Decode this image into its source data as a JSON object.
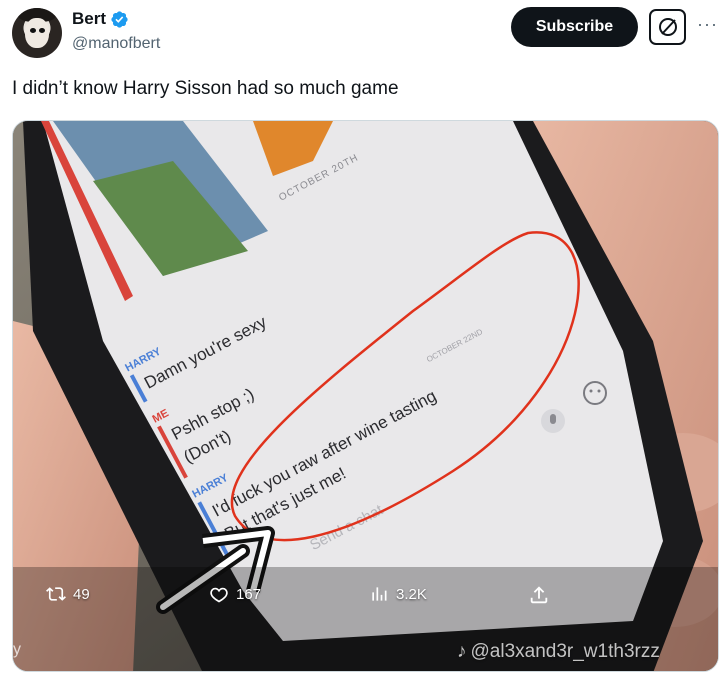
{
  "author": {
    "name": "Bert",
    "handle": "@manofbert",
    "verified": true
  },
  "actions": {
    "subscribe_label": "Subscribe",
    "grok_icon": "grok-icon",
    "more_icon": "more-icon"
  },
  "tweet": {
    "text": "I didn’t know Harry Sisson had so much game"
  },
  "media": {
    "chat": {
      "date_label": "OCTOBER 20TH",
      "messages": [
        {
          "sender": "HARRY",
          "text": "Damn you're sexy"
        },
        {
          "sender": "ME",
          "text": "Pshh stop ;)"
        },
        {
          "sender": "",
          "text": "(Don't)"
        },
        {
          "sender": "HARRY",
          "text": "I'd fuck you raw after wine tasting"
        },
        {
          "sender": "",
          "text": "But that's just me!"
        }
      ],
      "send_placeholder": "Send a chat",
      "second_date": "OCTOBER 22ND"
    },
    "stats": {
      "retweets": "49",
      "likes": "167",
      "views": "3.2K"
    },
    "watermark": "@al3xand3r_w1th3rzz",
    "corner_text": "y"
  },
  "colors": {
    "accent": "#0f1419",
    "verified": "#1d9bf0",
    "circle": "#e0321c",
    "harry": "#4a7fd6",
    "me": "#d9443b"
  }
}
